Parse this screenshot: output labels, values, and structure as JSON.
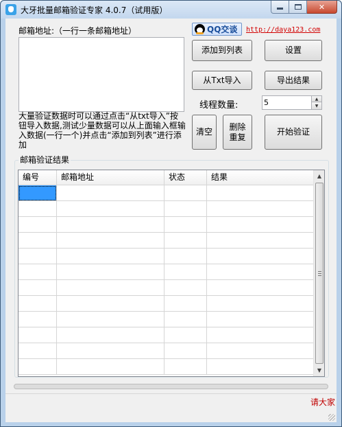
{
  "window": {
    "title": "大牙批量邮箱验证专家 4.0.7（试用版）"
  },
  "input_section": {
    "label": "邮箱地址:（一行一条邮箱地址）",
    "textarea_value": "",
    "hint": "大量验证数据时可以通过点击“从txt导入”按钮导入数据,测试少量数据可以从上面输入框输入数据(一行一个)并点击“添加到列表”进行添加"
  },
  "header_links": {
    "qq_label": "QQ交谈",
    "site_url": "http://daya123.com"
  },
  "buttons": {
    "add_to_list": "添加到列表",
    "settings": "设置",
    "import_txt": "从Txt导入",
    "export_results": "导出结果",
    "clear": "清空",
    "remove_duplicates": "删除\n重复",
    "start_verify": "开始验证"
  },
  "thread": {
    "label": "线程数量:",
    "value": "5"
  },
  "results": {
    "group_title": "邮箱验证结果",
    "columns": [
      "编号",
      "邮箱地址",
      "状态",
      "结果"
    ],
    "rows": []
  },
  "status_bar": {
    "text": "请大家"
  },
  "colors": {
    "accent": "#3399ff",
    "link": "#d20000",
    "status_text": "#c00000"
  }
}
